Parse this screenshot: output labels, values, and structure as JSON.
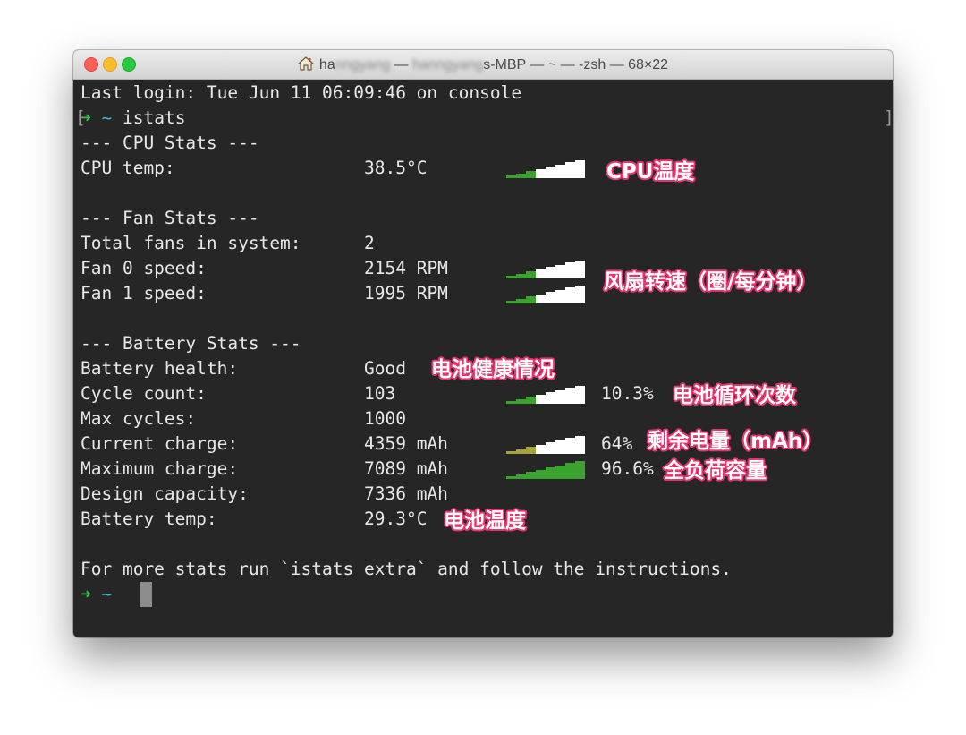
{
  "window": {
    "title_prefix": "ha",
    "title_blurred_1": "nngyang",
    "title_sep_1": " — ",
    "title_blurred_2": "hanngyang",
    "title_visible": "s-MBP — ~ — -zsh — 68×22"
  },
  "terminal": {
    "last_login": "Last login: Tue Jun 11 06:09:46 on console",
    "command": "istats",
    "cpu_header": "--- CPU Stats ---",
    "cpu_temp": {
      "label": "CPU temp:",
      "value": "38.5°C",
      "level": 0.7
    },
    "fan_header": "--- Fan Stats ---",
    "total_fans": {
      "label": "Total fans in system:",
      "value": "2"
    },
    "fan0": {
      "label": "Fan 0 speed:",
      "value": "2154 RPM",
      "level": 0.7
    },
    "fan1": {
      "label": "Fan 1 speed:",
      "value": "1995 RPM",
      "level": 0.7
    },
    "battery_header": "--- Battery Stats ---",
    "battery_health": {
      "label": "Battery health:",
      "value": "Good"
    },
    "cycle_count": {
      "label": "Cycle count:",
      "value": "103",
      "percent": "10.3%",
      "level": 0.7
    },
    "max_cycles": {
      "label": "Max cycles:",
      "value": "1000"
    },
    "current_charge": {
      "label": "Current charge:",
      "value": "4359 mAh",
      "percent": "64%",
      "level": 0.64
    },
    "maximum_charge": {
      "label": "Maximum charge:",
      "value": "7089 mAh",
      "percent": "96.6%",
      "level": 0.966
    },
    "design_capacity": {
      "label": "Design capacity:",
      "value": "7336 mAh"
    },
    "battery_temp": {
      "label": "Battery temp:",
      "value": "29.3°C"
    },
    "footer": "For more stats run `istats extra` and follow the instructions.",
    "prompt_arrow": "➜",
    "prompt_tilde": "~"
  },
  "annotations": {
    "cpu_temp": "CPU温度",
    "fan_speed": "风扇转速（圈/每分钟）",
    "battery_health": "电池健康情况",
    "cycle_count": "电池循环次数",
    "current_charge": "剩余电量（mAh）",
    "full_capacity": "全负荷容量",
    "battery_temp": "电池温度"
  },
  "colors": {
    "bar_green": "#3aa22f",
    "bar_olive": "#a6a23c",
    "bar_white": "#ffffff",
    "annotation_outline": "#e8336e",
    "prompt_green": "#34c24c",
    "prompt_cyan": "#3bb7c6"
  }
}
